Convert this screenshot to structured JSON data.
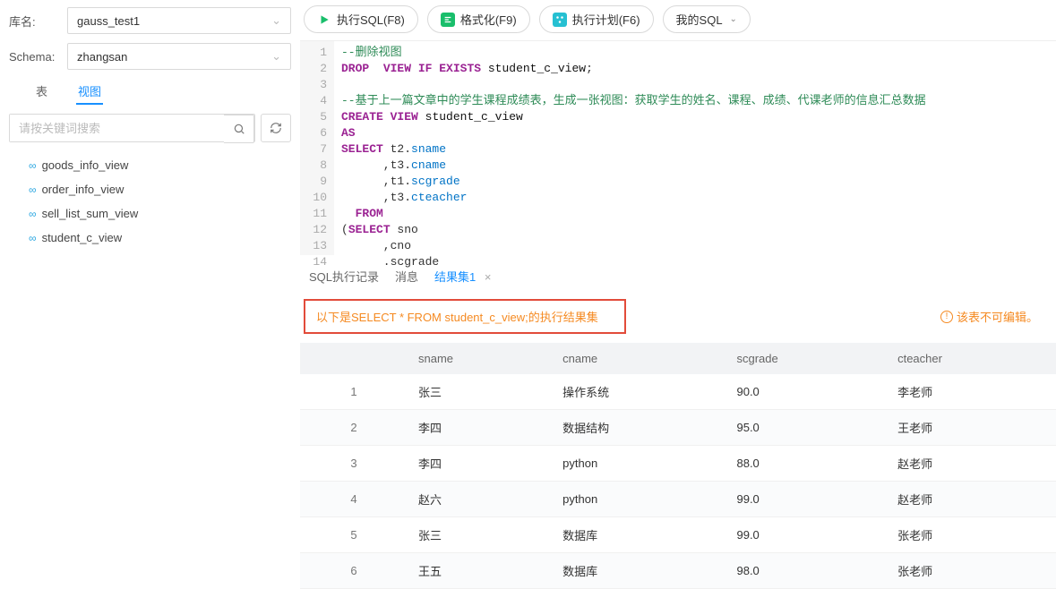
{
  "sidebar": {
    "db_label": "库名:",
    "db_value": "gauss_test1",
    "schema_label": "Schema:",
    "schema_value": "zhangsan",
    "tab_table": "表",
    "tab_view": "视图",
    "search_placeholder": "请按关键词搜索",
    "tree": [
      "goods_info_view",
      "order_info_view",
      "sell_list_sum_view",
      "student_c_view"
    ]
  },
  "toolbar": {
    "run": "执行SQL(F8)",
    "format": "格式化(F9)",
    "plan": "执行计划(F6)",
    "mysql": "我的SQL"
  },
  "editor": {
    "lines": [
      {
        "n": 1,
        "html": "<span class='c-comment'>--删除视图</span>"
      },
      {
        "n": 2,
        "html": "<span class='c-key'>DROP</span>&nbsp;&nbsp;<span class='c-key'>VIEW IF EXISTS</span> <span class='c-id'>student_c_view</span>;"
      },
      {
        "n": 3,
        "html": ""
      },
      {
        "n": 4,
        "html": "<span class='c-comment'>--基于上一篇文章中的学生课程成绩表，生成一张视图：获取学生的姓名、课程、成绩、代课老师的信息汇总数据</span>"
      },
      {
        "n": 5,
        "html": "<span class='c-key'>CREATE VIEW</span> <span class='c-id'>student_c_view</span>"
      },
      {
        "n": 6,
        "html": "<span class='c-key'>AS</span>"
      },
      {
        "n": 7,
        "html": "<span class='c-key'>SELECT</span> t2.<span class='c-col'>sname</span>"
      },
      {
        "n": 8,
        "html": "      ,t3.<span class='c-col'>cname</span>"
      },
      {
        "n": 9,
        "html": "      ,t1.<span class='c-col'>scgrade</span>"
      },
      {
        "n": 10,
        "html": "      ,t3.<span class='c-col'>cteacher</span>"
      },
      {
        "n": 11,
        "html": "  <span class='c-key'>FROM</span>"
      },
      {
        "n": 12,
        "html": "(<span class='c-key'>SELECT</span> sno"
      },
      {
        "n": 13,
        "html": "      ,cno"
      },
      {
        "n": 14,
        "html": "      .scgrade"
      }
    ]
  },
  "result_tabs": {
    "history": "SQL执行记录",
    "messages": "消息",
    "set1": "结果集1"
  },
  "notice": "以下是SELECT * FROM student_c_view;的执行结果集",
  "warn": "该表不可编辑。",
  "columns": [
    "",
    "sname",
    "cname",
    "scgrade",
    "cteacher"
  ],
  "rows": [
    {
      "i": 1,
      "sname": "张三",
      "cname": "操作系统",
      "scgrade": "90.0",
      "cteacher": "李老师"
    },
    {
      "i": 2,
      "sname": "李四",
      "cname": "数据结构",
      "scgrade": "95.0",
      "cteacher": "王老师"
    },
    {
      "i": 3,
      "sname": "李四",
      "cname": "python",
      "scgrade": "88.0",
      "cteacher": "赵老师"
    },
    {
      "i": 4,
      "sname": "赵六",
      "cname": "python",
      "scgrade": "99.0",
      "cteacher": "赵老师"
    },
    {
      "i": 5,
      "sname": "张三",
      "cname": "数据库",
      "scgrade": "99.0",
      "cteacher": "张老师"
    },
    {
      "i": 6,
      "sname": "王五",
      "cname": "数据库",
      "scgrade": "98.0",
      "cteacher": "张老师"
    }
  ]
}
